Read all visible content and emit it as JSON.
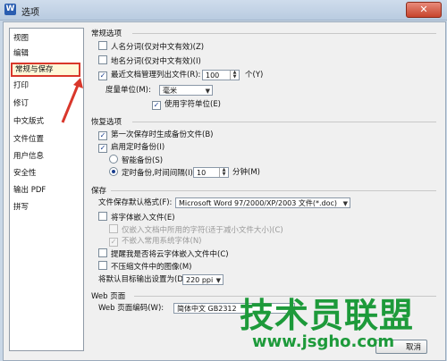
{
  "window": {
    "title": "选项",
    "app_icon": "W"
  },
  "sidebar": {
    "items": [
      {
        "label": "视图"
      },
      {
        "label": "编辑"
      },
      {
        "label": "常规与保存"
      },
      {
        "label": "打印"
      },
      {
        "label": "修订"
      },
      {
        "label": "中文版式"
      },
      {
        "label": "文件位置"
      },
      {
        "label": "用户信息"
      },
      {
        "label": "安全性"
      },
      {
        "label": "输出 PDF"
      },
      {
        "label": "拼写"
      }
    ],
    "selected_index": 2
  },
  "general": {
    "title": "常规选项",
    "person_name": {
      "label": "人名分词(仅对中文有效)(Z)",
      "checked": false
    },
    "place_name": {
      "label": "地名分词(仅对中文有效)(I)",
      "checked": false
    },
    "recent_files": {
      "label": "最近文档管理列出文件(R):",
      "checked": true,
      "value": "100",
      "unit": "个(Y)"
    },
    "measure_unit": {
      "label": "度量单位(M):",
      "value": "毫米"
    },
    "char_unit": {
      "label": "使用字符单位(E)",
      "checked": true
    }
  },
  "restore": {
    "title": "恢复选项",
    "backup_first": {
      "label": "第一次保存时生成备份文件(B)",
      "checked": true
    },
    "timed_backup": {
      "label": "启用定时备份(I)",
      "checked": true
    },
    "smart_backup": {
      "label": "智能备份(S)",
      "selected": false
    },
    "interval_backup": {
      "label": "定时备份,时间间隔(I):",
      "selected": true,
      "value": "10",
      "unit": "分钟(M)"
    }
  },
  "save": {
    "title": "保存",
    "default_format": {
      "label": "文件保存默认格式(F):",
      "value": "Microsoft Word 97/2000/XP/2003 文件(*.doc)"
    },
    "embed_fonts": {
      "label": "将字体嵌入文件(E)",
      "checked": false
    },
    "embed_used_only": {
      "label": "仅嵌入文档中所用的字符(适于减小文件大小)(C)",
      "checked": false
    },
    "no_common_fonts": {
      "label": "不嵌入常用系统字体(N)",
      "checked": true
    },
    "remind_cloud": {
      "label": "提醒我是否将云字体嵌入文件中(C)",
      "checked": false
    },
    "no_compress": {
      "label": "不压缩文件中的图像(M)",
      "checked": false
    },
    "default_resolution": {
      "label": "将默认目标输出设置为(D):",
      "value": "220 ppi"
    }
  },
  "web": {
    "title": "Web 页面",
    "encoding": {
      "label": "Web 页面编码(W):",
      "value": "简体中文 GB2312"
    }
  },
  "watermark": {
    "text": "技术员联盟",
    "url": "www.jsgho.com"
  },
  "buttons": {
    "cancel": "取消"
  },
  "colors": {
    "highlight": "#d9372b",
    "watermark": "#1d9a3a"
  }
}
